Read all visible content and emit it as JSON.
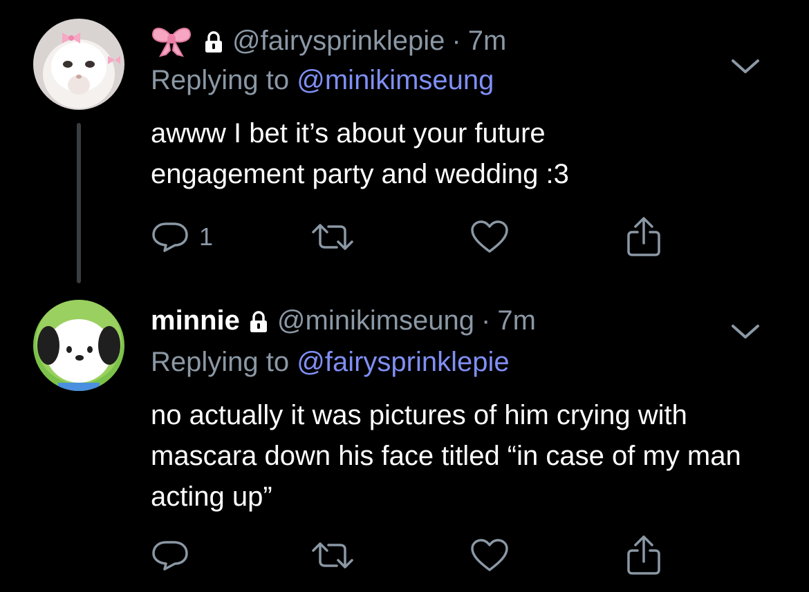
{
  "tweets": [
    {
      "display_name": "",
      "handle": "@fairysprinklepie",
      "time": "7m",
      "replying_prefix": "Replying to",
      "replying_to": "@minikimseung",
      "text": "awww I bet it’s about your future engagement party and wedding :3",
      "reply_count": "1",
      "locked": true,
      "name_emoji": "ribbon-icon"
    },
    {
      "display_name": "minnie",
      "handle": "@minikimseung",
      "time": "7m",
      "replying_prefix": "Replying to",
      "replying_to": "@fairysprinklepie",
      "text": "no actually it was pictures of him crying with mascara down his face titled “in case of my man acting up”",
      "reply_count": "",
      "locked": true
    }
  ],
  "separator": "·",
  "colors": {
    "background": "#000000",
    "text": "#ffffff",
    "muted": "#8b98a5",
    "mention": "#7f8ff4",
    "thread_line": "#3a3d42"
  }
}
